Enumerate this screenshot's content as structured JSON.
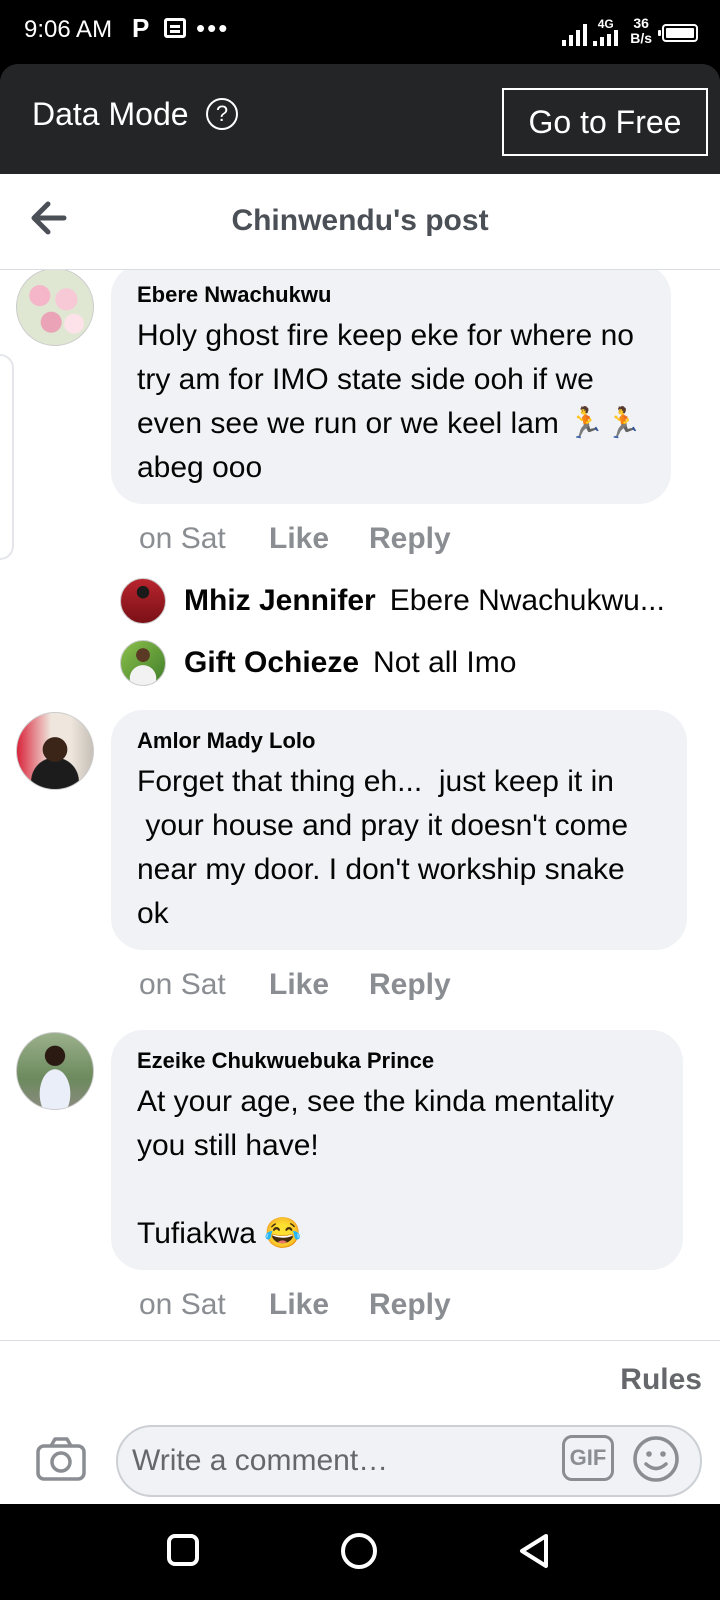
{
  "status_bar": {
    "time": "9:06 AM",
    "net_type": "4G",
    "speed_value": "36",
    "speed_unit": "B/s"
  },
  "data_mode": {
    "label": "Data Mode",
    "help_symbol": "?",
    "go_free_label": "Go to Free"
  },
  "header": {
    "title": "Chinwendu's post"
  },
  "comments": [
    {
      "author": "Ebere Nwachukwu",
      "text": "Holy ghost fire keep eke for where no try am for IMO state side ooh if we even see we run or we keel lam 🏃🏃abeg ooo",
      "time": "on Sat",
      "like": "Like",
      "reply": "Reply",
      "replies": [
        {
          "name": "Mhiz Jennifer",
          "text": "Ebere Nwachukwu"
        },
        {
          "name": "Gift Ochieze",
          "text": "Not all Imo"
        }
      ]
    },
    {
      "author": "Amlor Mady Lolo",
      "text": "Forget that thing eh...  just keep it in\n your house and pray it doesn't come near my door. I don't workship snake ok",
      "time": "on Sat",
      "like": "Like",
      "reply": "Reply"
    },
    {
      "author": "Ezeike Chukwuebuka Prince",
      "text": "At your age, see the kinda mentality you still have!\n\nTufiakwa 😂",
      "time": "on Sat",
      "like": "Like",
      "reply": "Reply"
    }
  ],
  "composer": {
    "rules_label": "Rules",
    "placeholder": "Write a comment…",
    "gif_label": "GIF"
  },
  "colors": {
    "dark_bar": "#242526",
    "bubble": "#f0f2f5",
    "muted_text": "#8a8d91"
  }
}
